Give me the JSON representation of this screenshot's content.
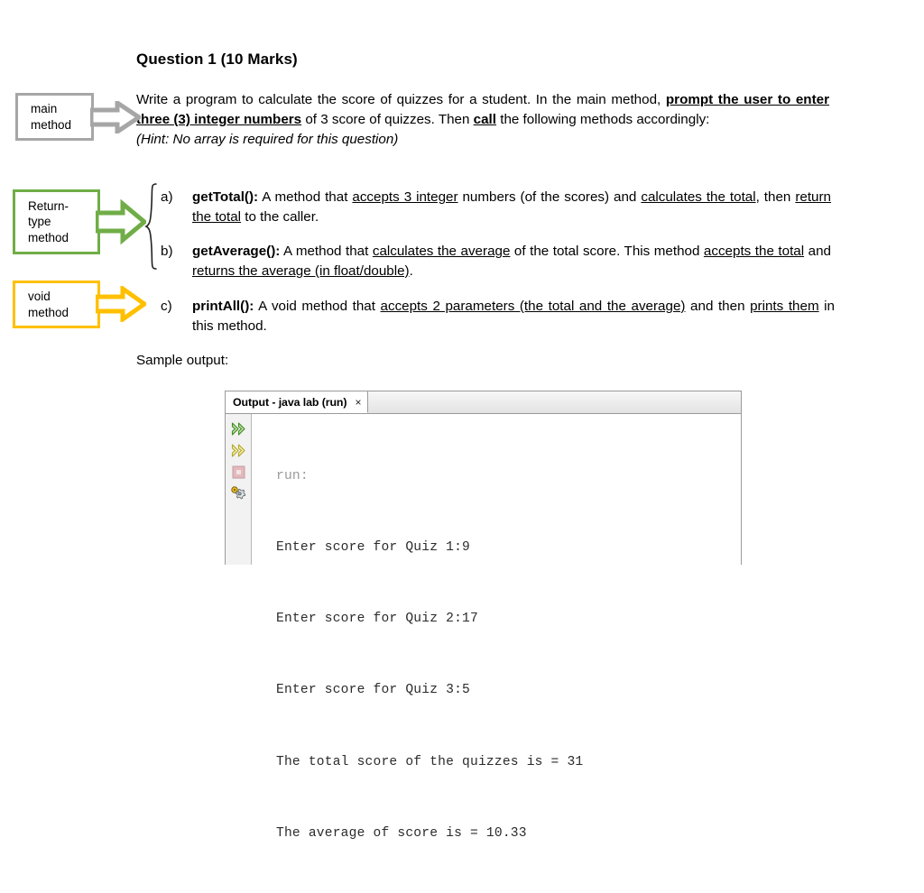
{
  "page": {
    "title": "Question 1 (10 Marks)",
    "sample_output_label": "Sample output:"
  },
  "intro": {
    "part1": "Write a program to calculate the score of quizzes for a student. In the main method, ",
    "emphasis1": "prompt the user to enter three (3) integer numbers",
    "part2": " of 3 score of quizzes. Then ",
    "emphasis2": "call",
    "part3": " the following methods accordingly:",
    "hint": "(Hint: No array is required for this question)"
  },
  "callouts": [
    {
      "name": "main-method",
      "label": "main\nmethod",
      "color": "#a6a6a6"
    },
    {
      "name": "return-type-method",
      "label": "Return-\ntype\nmethod",
      "color": "#70ad47"
    },
    {
      "name": "void-method",
      "label": "void\nmethod",
      "color": "#ffc000"
    }
  ],
  "methods": [
    {
      "marker": "a)",
      "name": "getTotal():",
      "seg1": " A method that ",
      "u1": "accepts 3 integer",
      "seg2": " numbers (of the scores) and ",
      "u2": "calculates the total",
      "seg3": ", then ",
      "u3": "return the total",
      "seg4": " to the caller."
    },
    {
      "marker": "b)",
      "name": "getAverage():",
      "seg1": " A method that ",
      "u1": "calculates the average",
      "seg2": " of the total score. This method ",
      "u2": "accepts the total",
      "seg3": " and ",
      "u3": "returns the average (in float/double)",
      "seg4": "."
    },
    {
      "marker": "c)",
      "name": "printAll():",
      "seg1": " A void method that ",
      "u1": "accepts 2 parameters (the total and the average)",
      "seg2": " and then ",
      "u2": "prints them",
      "seg3": " in this method.",
      "u3": "",
      "seg4": ""
    }
  ],
  "output_window": {
    "tab_label": "Output - java lab (run)",
    "tab_close": "×",
    "gutter_icons": [
      "run-icon",
      "rerun-icon",
      "stop-icon",
      "settings-icon"
    ],
    "console_lines": [
      {
        "text": "run:",
        "dim": true
      },
      {
        "text": "Enter score for Quiz 1:9",
        "dim": false
      },
      {
        "text": "Enter score for Quiz 2:17",
        "dim": false
      },
      {
        "text": "Enter score for Quiz 3:5",
        "dim": false
      },
      {
        "text": "The total score of the quizzes is = 31",
        "dim": false
      },
      {
        "text": "The average of score is = 10.33",
        "dim": false
      }
    ]
  }
}
